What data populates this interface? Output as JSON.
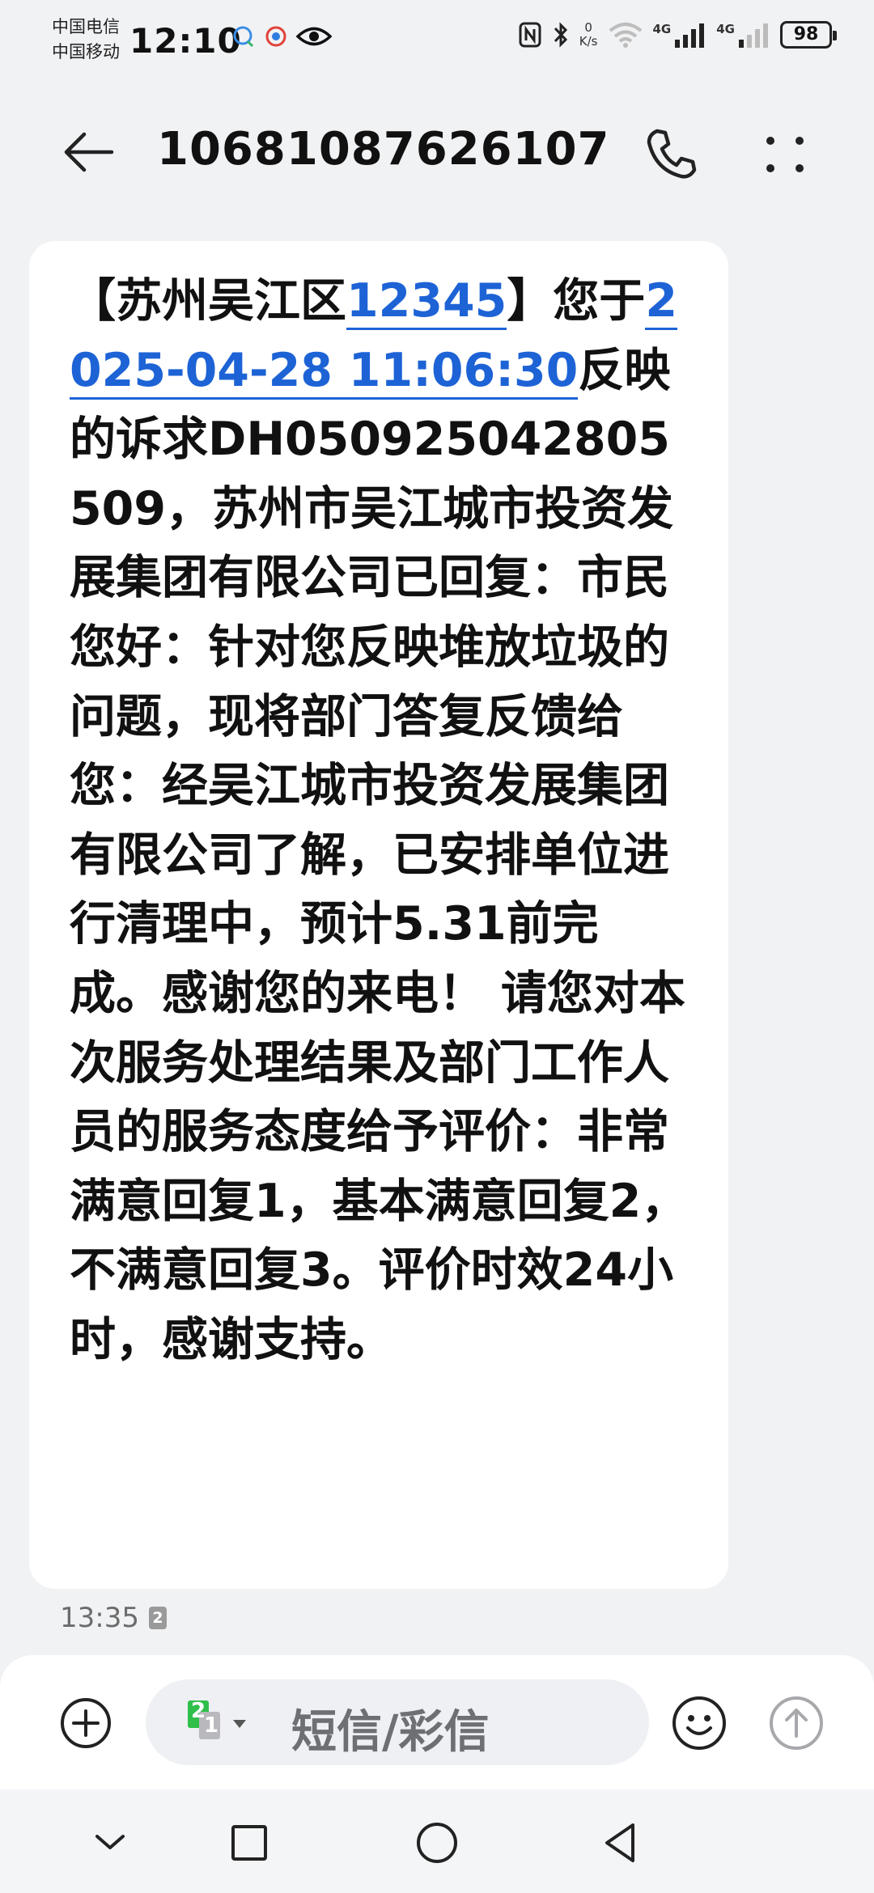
{
  "status_bar": {
    "carrier_1": "中国电信",
    "carrier_2": "中国移动",
    "time": "12:10",
    "net_speed_value": "0",
    "net_speed_unit": "K/s",
    "signal_1_label": "4G",
    "signal_2_label": "4G",
    "battery": "98",
    "notification_icons": [
      "chat-bubble-icon",
      "app-icon",
      "eye-icon"
    ],
    "system_icons": [
      "nfc-icon",
      "bluetooth-icon",
      "wifi-icon",
      "signal-icon",
      "signal-icon",
      "battery-icon"
    ]
  },
  "header": {
    "contact": "10681087626107",
    "icons": [
      "back-arrow-icon",
      "phone-icon",
      "more-icon"
    ]
  },
  "message": {
    "part_1": "【苏州吴江区",
    "link_1": "12345",
    "part_2": "】您于",
    "link_2": "2025-04-28 11:06:30",
    "part_3": "反映的诉求DH050925042805509，苏州市吴江城市投资发展集团有限公司已回复：市民您好：针对您反映堆放垃圾的问题，现将部门答复反馈给您：经吴江城市投资发展集团有限公司了解，已安排单位进行清理中，预计5.31前完成。感谢您的来电！  请您对本次服务处理结果及部门工作人员的服务态度给予评价：非常满意回复1，基本满意回复2，不满意回复3。评价时效24小时，感谢支持。",
    "time": "13:35",
    "sim": "2"
  },
  "composer": {
    "placeholder": "短信/彩信",
    "sim_primary": "2",
    "sim_secondary": "1",
    "icons": [
      "add-icon",
      "emoji-icon",
      "send-icon"
    ]
  },
  "navbar": {
    "icons": [
      "nav-down-icon",
      "nav-recents-icon",
      "nav-home-icon",
      "nav-back-icon"
    ]
  },
  "colors": {
    "link": "#1d63d6",
    "background": "#f1f2f4",
    "bubble": "#ffffff",
    "sim_green": "#2fbf4a"
  }
}
